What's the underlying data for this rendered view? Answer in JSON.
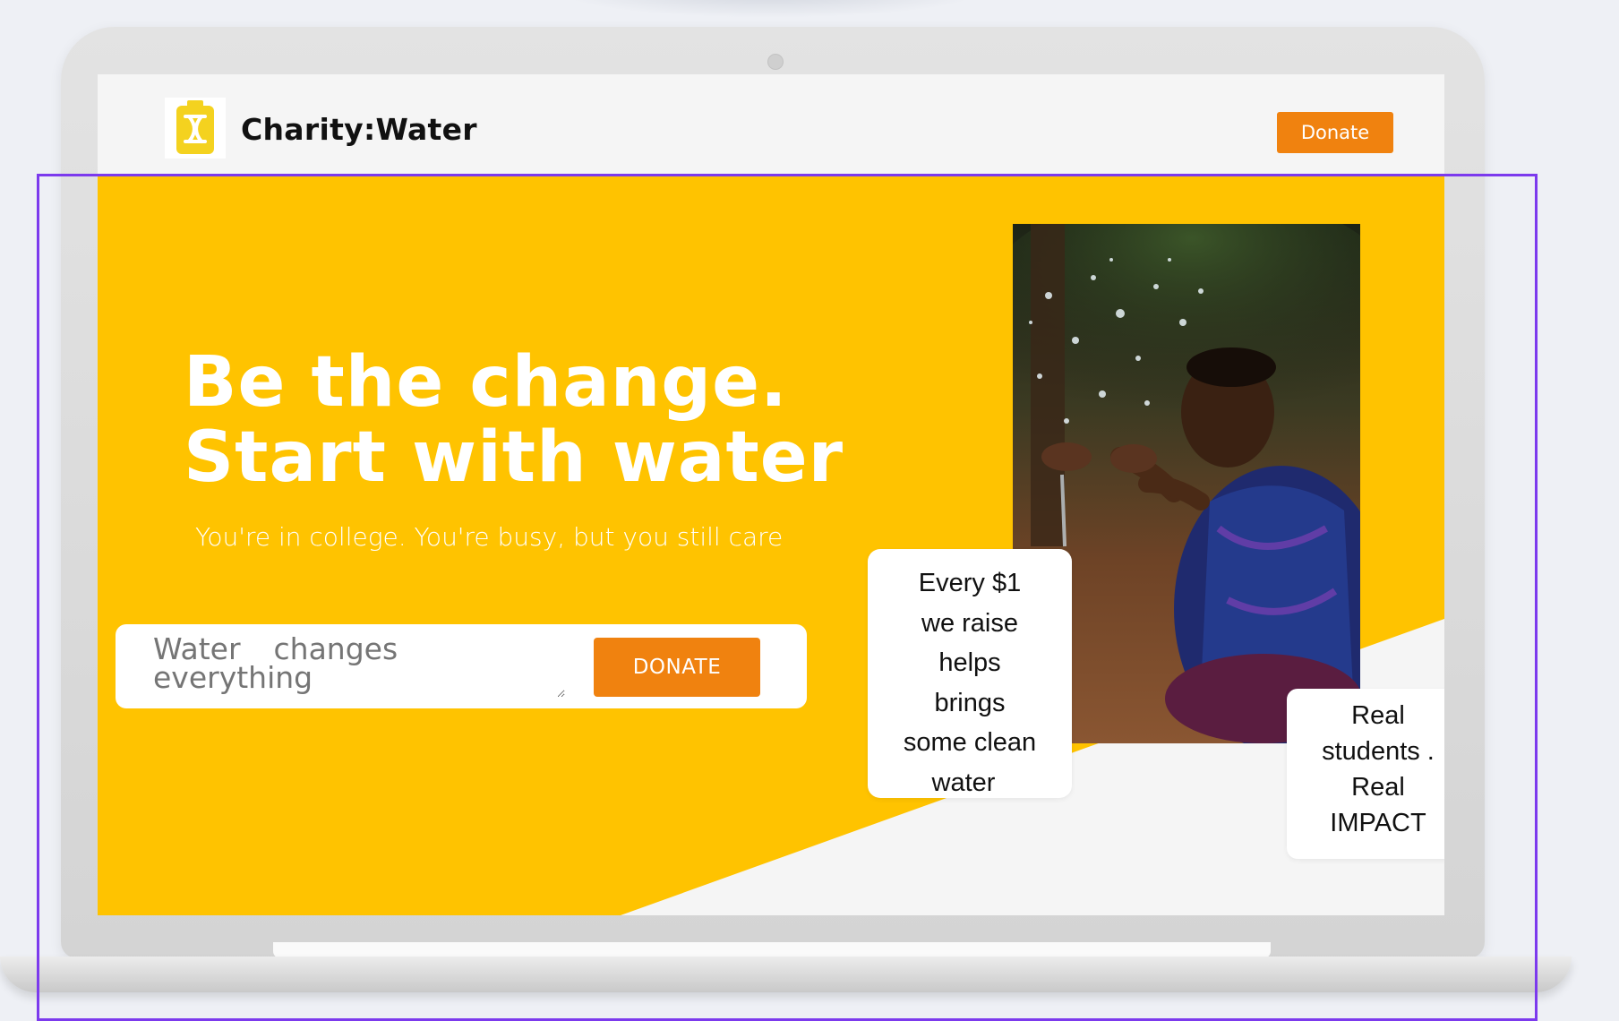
{
  "brand": {
    "name": "Charity:Water",
    "logo_icon": "jerrycan-icon"
  },
  "nav": {
    "donate_label": "Donate"
  },
  "hero": {
    "title_line1": "Be the change.",
    "title_line2": "Start with water",
    "subtitle": "You're in college. You're busy, but you still care",
    "cta_placeholder": "Water  changes everything",
    "cta_button_label": "DONATE"
  },
  "stats": {
    "lines": [
      "Every $1",
      "we raise",
      "helps",
      "brings",
      "some clean",
      "water"
    ]
  },
  "impact": {
    "lines": [
      "Real",
      "students .",
      "Real",
      "IMPACT"
    ]
  },
  "colors": {
    "accent_yellow": "#ffc300",
    "accent_orange": "#f0820f",
    "selection": "#7c3aed"
  }
}
